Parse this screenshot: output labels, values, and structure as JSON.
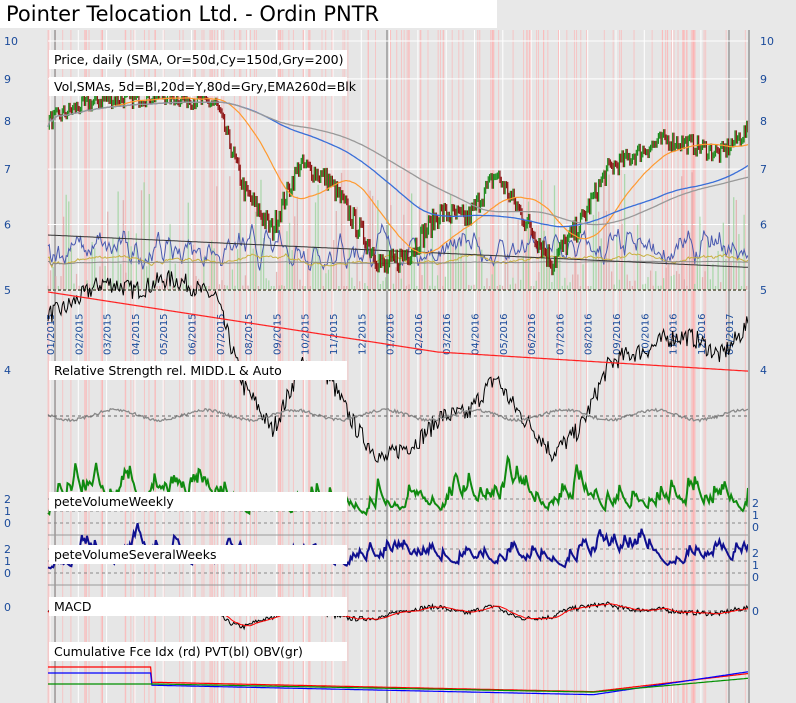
{
  "title": "Pointer Telocation Ltd. - Ordin PNTR",
  "chart_data": {
    "type": "line",
    "title": "Pointer Telocation Ltd. - Ordin PNTR",
    "panels": [
      {
        "label": "Price, daily (SMA, Or=50d,Cy=150d,Gry=200)",
        "ylim": [
          5,
          10
        ],
        "yticks": [
          "10",
          "9",
          "8",
          "7",
          "6",
          "5"
        ],
        "scale": "log"
      },
      {
        "label": "Vol,SMAs, 5d=Bl,20d=Y,80d=Gry,EMA260d=Blk"
      },
      {
        "label": "Relative Strength rel. MIDD.L & Auto",
        "yticks": [
          "4"
        ]
      },
      {
        "label": "peteVolumeWeekly",
        "yticks": [
          "2",
          "1",
          "0"
        ]
      },
      {
        "label": "peteVolumeSeveralWeeks",
        "yticks": [
          "2",
          "1",
          "0"
        ]
      },
      {
        "label": "MACD",
        "yticks": [
          "0"
        ]
      },
      {
        "label": "Cumulative Fce Idx (rd) PVT(bl) OBV(gr)"
      }
    ],
    "x_tick_labels": [
      "01/2015",
      "02/2015",
      "03/2015",
      "04/2015",
      "05/2015",
      "06/2015",
      "07/2015",
      "08/2015",
      "09/2015",
      "10/2015",
      "11/2015",
      "12/2015",
      "01/2016",
      "02/2016",
      "03/2016",
      "04/2016",
      "05/2016",
      "06/2016",
      "07/2016",
      "08/2016",
      "09/2016",
      "10/2016",
      "11/2016",
      "12/2016",
      "01/2017"
    ],
    "price_monthly_approx": {
      "x": [
        "01/2015",
        "02/2015",
        "03/2015",
        "04/2015",
        "05/2015",
        "06/2015",
        "07/2015",
        "08/2015",
        "09/2015",
        "10/2015",
        "11/2015",
        "12/2015",
        "01/2016",
        "02/2016",
        "03/2016",
        "04/2016",
        "05/2016",
        "06/2016",
        "07/2016",
        "08/2016",
        "09/2016",
        "10/2016",
        "11/2016",
        "12/2016",
        "01/2017",
        "02/2017"
      ],
      "close": [
        8.0,
        8.3,
        8.5,
        8.5,
        8.6,
        8.5,
        8.4,
        6.6,
        5.9,
        7.1,
        6.8,
        6.0,
        5.3,
        5.6,
        6.2,
        6.1,
        6.9,
        6.1,
        5.4,
        6.0,
        7.0,
        7.3,
        7.6,
        7.5,
        7.3,
        7.8
      ]
    },
    "colors": {
      "up": "#1a8a1a",
      "down": "#8b1010",
      "sma50": "#ff9a30",
      "sma150": "#3a6fd8",
      "sma200": "#999999",
      "rs": "#000000",
      "rs_ma": "#ff2020",
      "weekly": "#108a10",
      "several": "#101090",
      "fce": "#ff0000",
      "pvt": "#0000ff",
      "obv": "#009000"
    }
  }
}
